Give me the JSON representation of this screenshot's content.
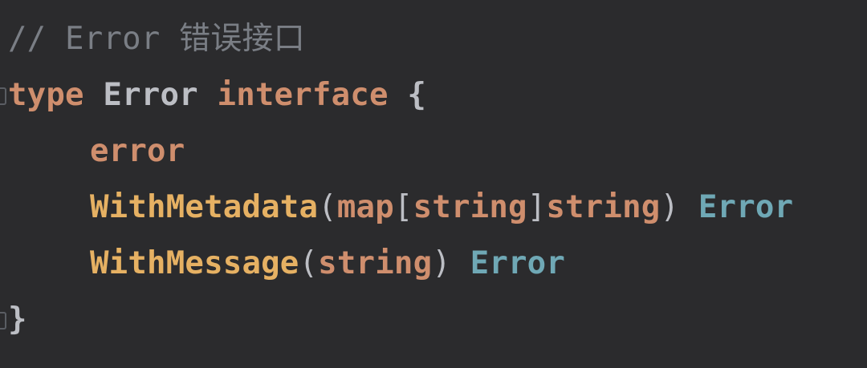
{
  "code": {
    "comment": {
      "prefix": "// ",
      "word": "Error",
      "cjk": "错误接口"
    },
    "decl": {
      "kw_type": "type",
      "name": "Error",
      "kw_interface": "interface",
      "open_brace": "{"
    },
    "line_embed": {
      "kw": "error"
    },
    "line_meta": {
      "method": "WithMetadata",
      "open_paren": "(",
      "kw_map": "map",
      "open_bracket": "[",
      "key_type": "string",
      "close_bracket": "]",
      "val_type": "string",
      "close_paren": ")",
      "ret": "Error"
    },
    "line_msg": {
      "method": "WithMessage",
      "open_paren": "(",
      "param_type": "string",
      "close_paren": ")",
      "ret": "Error"
    },
    "close_brace": "}"
  },
  "icons": {
    "fold_open": "fold-marker-icon",
    "fold_close": "fold-marker-icon"
  },
  "colors": {
    "background": "#2b2b2d",
    "comment": "#7a7e85",
    "keyword": "#cf8e6d",
    "type_name": "#bcbec4",
    "method": "#e6b163",
    "reference_type": "#6fa8b5"
  }
}
